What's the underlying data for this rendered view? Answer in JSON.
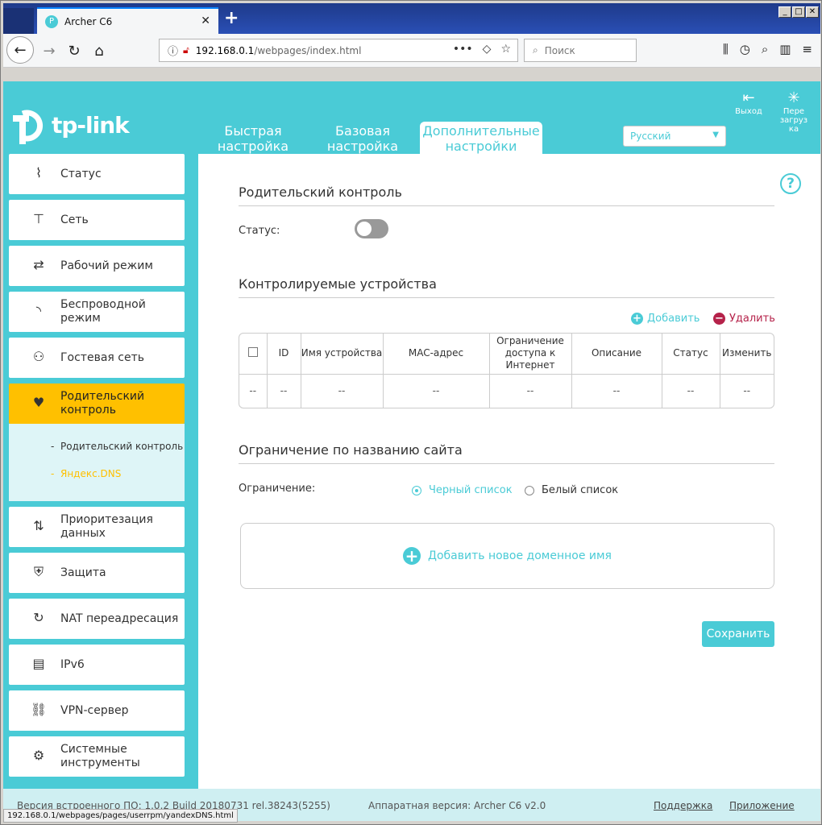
{
  "browser": {
    "tab_title": "Archer C6",
    "url_host": "192.168.0.1",
    "url_path": "/webpages/index.html",
    "search_placeholder": "Поиск",
    "status_url": "192.168.0.1/webpages/pages/userrpm/yandexDNS.html"
  },
  "header": {
    "logo_text": "tp-link",
    "tabs": [
      {
        "label": "Быстрая настройка"
      },
      {
        "label": "Базовая настройка"
      },
      {
        "label": "Дополнительные настройки"
      }
    ],
    "language": "Русский",
    "logout_label": "Выход",
    "reboot_label": "Пере загруз ка"
  },
  "sidebar": {
    "items": [
      {
        "label": "Статус",
        "icon": "pulse-icon"
      },
      {
        "label": "Сеть",
        "icon": "network-icon"
      },
      {
        "label": "Рабочий режим",
        "icon": "mode-icon"
      },
      {
        "label": "Беспроводной режим",
        "icon": "wireless-icon"
      },
      {
        "label": "Гостевая сеть",
        "icon": "guest-icon"
      },
      {
        "label": "Родительский контроль",
        "icon": "heart-icon"
      },
      {
        "label": "Приоритезация данных",
        "icon": "qos-icon"
      },
      {
        "label": "Защита",
        "icon": "shield-icon"
      },
      {
        "label": "NAT переадресация",
        "icon": "nat-icon"
      },
      {
        "label": "IPv6",
        "icon": "ipv6-icon"
      },
      {
        "label": "VPN-сервер",
        "icon": "link-icon"
      },
      {
        "label": "Системные инструменты",
        "icon": "gear-icon"
      }
    ],
    "subitems": [
      {
        "label": "Родительский контроль"
      },
      {
        "label": "Яндекс.DNS"
      }
    ]
  },
  "main": {
    "section1_title": "Родительский контроль",
    "status_label": "Статус:",
    "section2_title": "Контролируемые устройства",
    "add_label": "Добавить",
    "delete_label": "Удалить",
    "table": {
      "headers": [
        "ID",
        "Имя устройства",
        "MAC-адрес",
        "Ограничение доступа к Интернет",
        "Описание",
        "Статус",
        "Изменить"
      ],
      "row": [
        "--",
        "--",
        "--",
        "--",
        "--",
        "--",
        "--",
        "--"
      ]
    },
    "section3_title": "Ограничение по названию сайта",
    "restriction_label": "Ограничение:",
    "radio_black": "Черный список",
    "radio_white": "Белый список",
    "add_domain": "Добавить новое доменное имя",
    "save": "Сохранить"
  },
  "footer": {
    "firmware": "Версия встроенного ПО: 1.0.2 Build 20180731 rel.38243(5255)",
    "hardware": "Аппаратная версия: Archer C6 v2.0",
    "support": "Поддержка",
    "app": "Приложение"
  }
}
